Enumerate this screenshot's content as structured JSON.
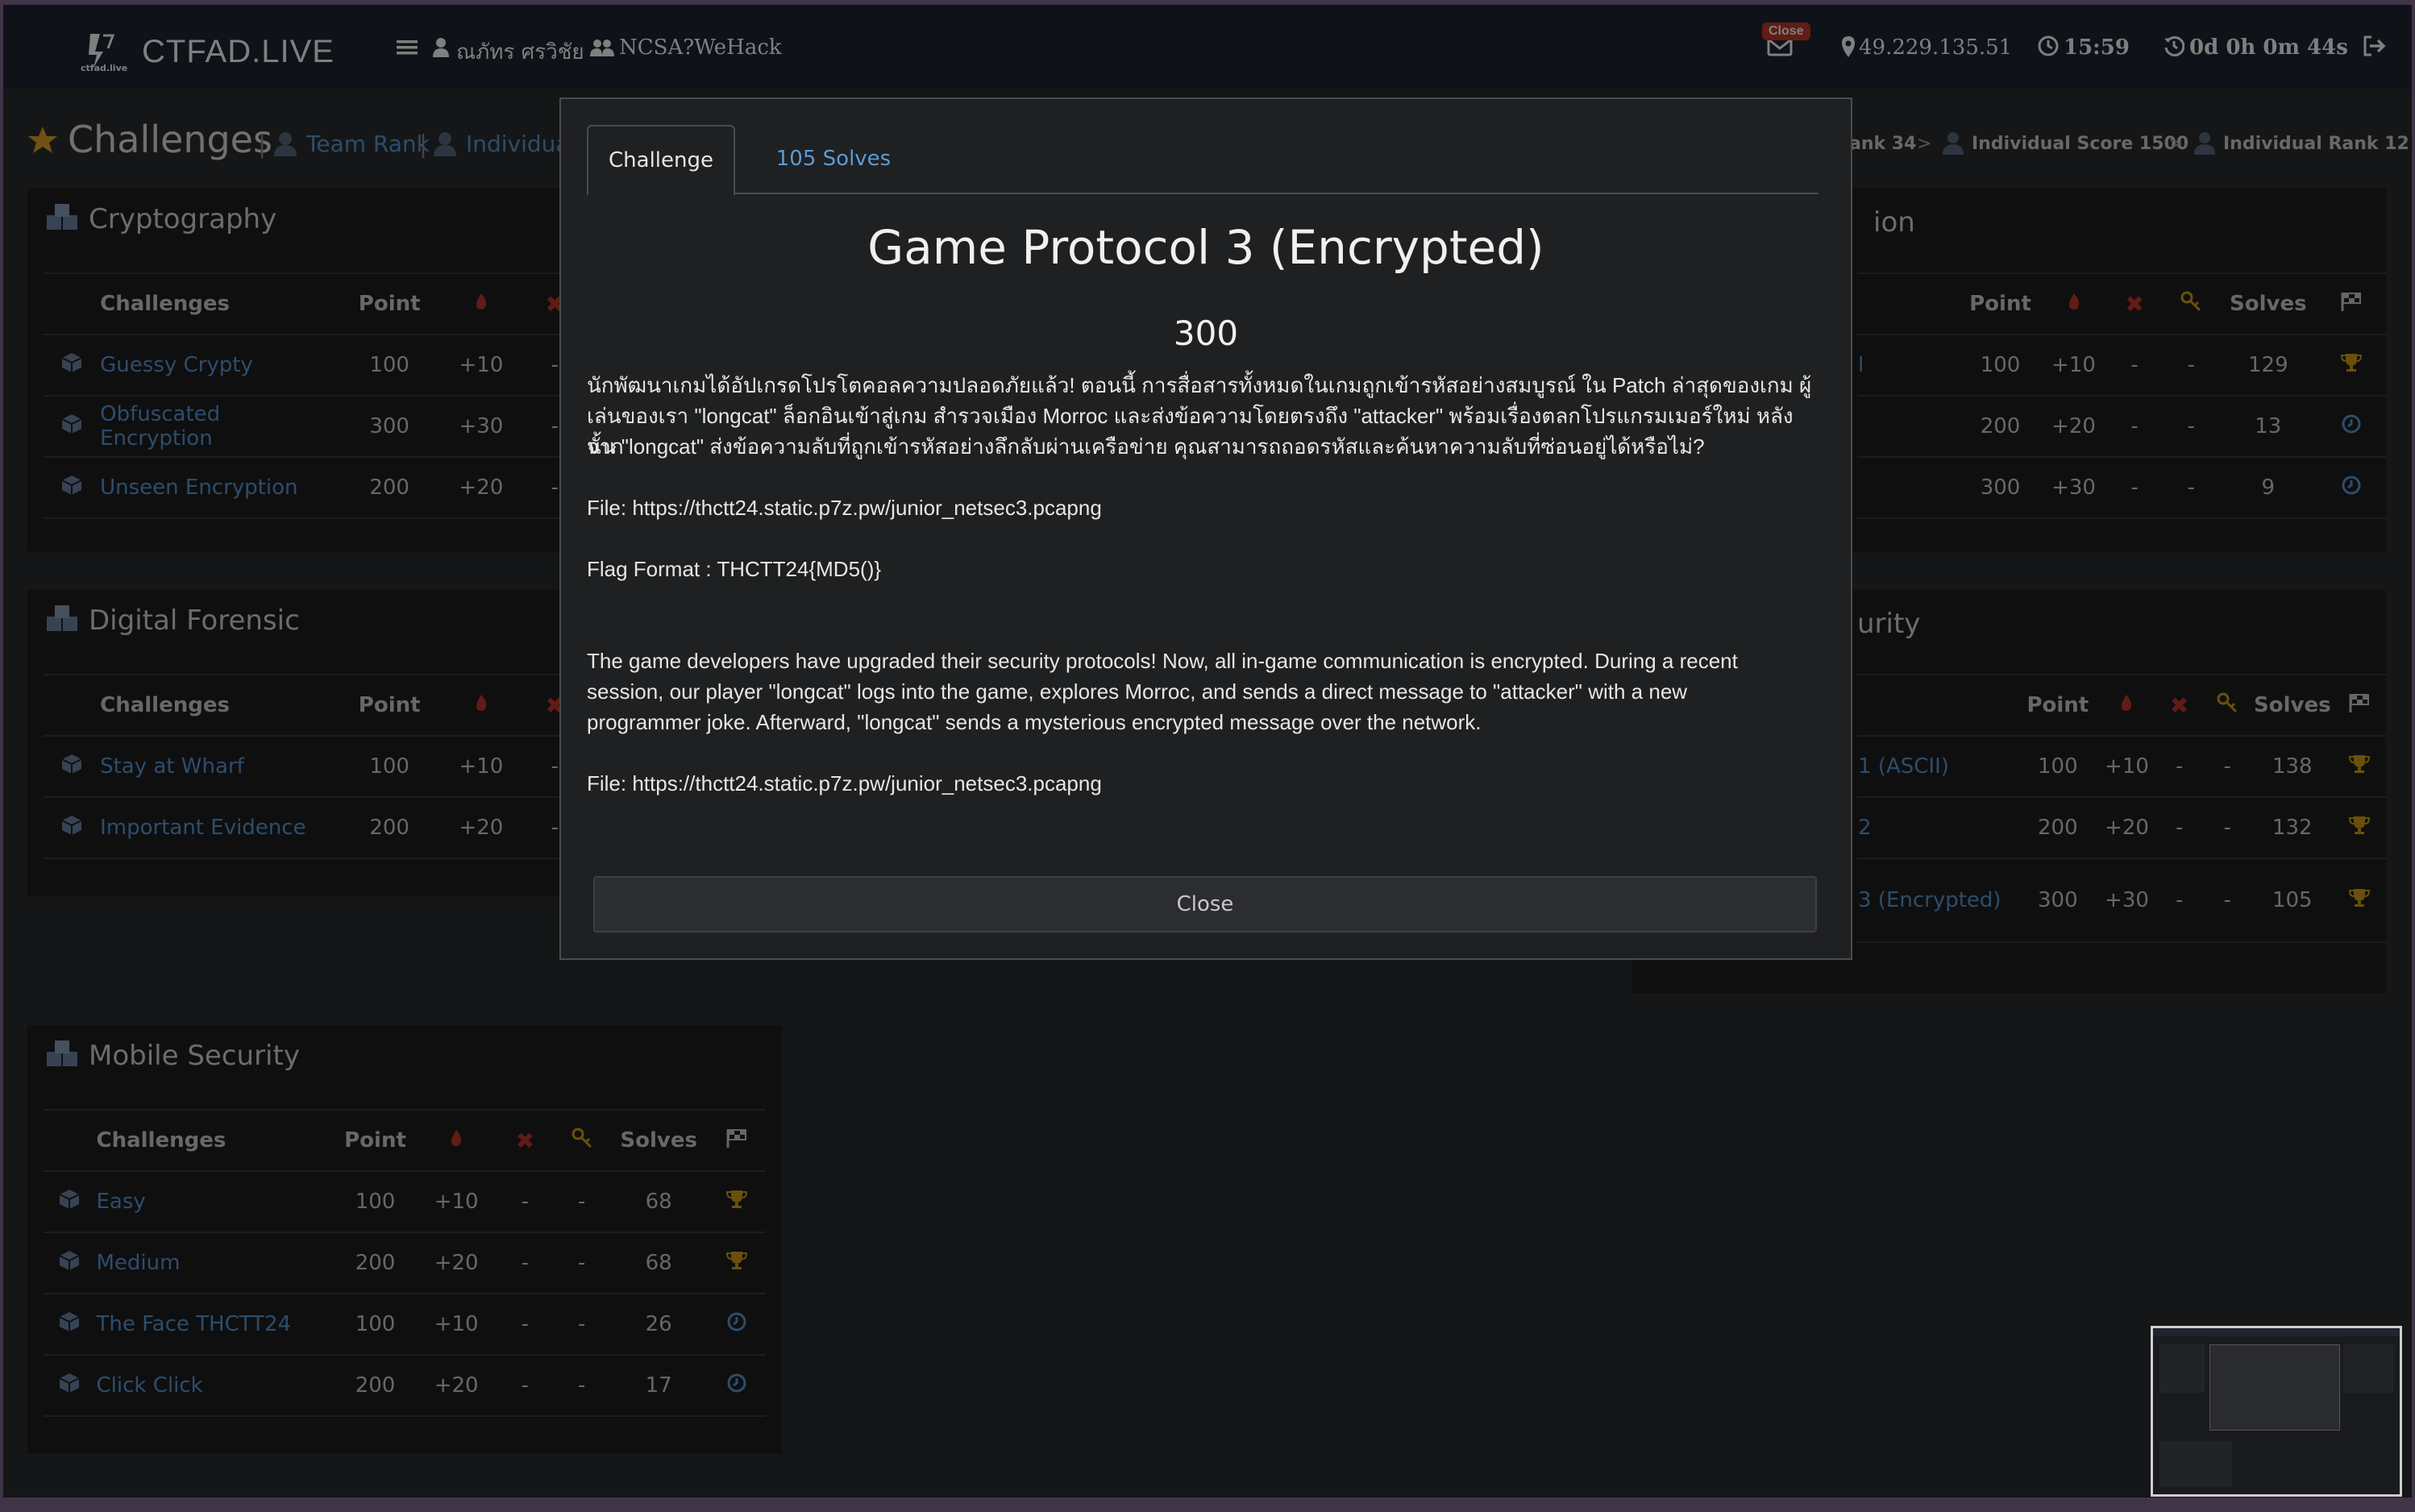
{
  "navbar": {
    "brand_title": "CTFAD.LIVE",
    "logo_caption": "ctfad.live",
    "user_name": "ณภัทร ศรวิชัย",
    "team_name": "NCSA?WeHack",
    "mail_badge": "Close",
    "ip_address": "49.229.135.51",
    "clock": "15:59",
    "timer": "0d 0h 0m 44s"
  },
  "page": {
    "heading": "Challenges",
    "breadcrumb_left": [
      "Team Rank",
      "Individua"
    ],
    "breadcrumb_right": {
      "team_rank": "ank 34",
      "individual_score": "Individual Score 1500",
      "individual_rank": "Individual Rank 12",
      "separator": ">"
    }
  },
  "columns": {
    "challenges": "Challenges",
    "point": "Point",
    "solves": "Solves"
  },
  "categories": {
    "cryptography": {
      "title": "Cryptography",
      "rows": [
        {
          "name": "Guessy Crypty",
          "point": "100",
          "bonus": "+10",
          "x": "-"
        },
        {
          "name": "Obfuscated Encryption",
          "point": "300",
          "bonus": "+30",
          "x": "-"
        },
        {
          "name": "Unseen Encryption",
          "point": "200",
          "bonus": "+20",
          "x": "-"
        }
      ]
    },
    "digital_forensic": {
      "title": "Digital Forensic",
      "rows": [
        {
          "name": "Stay at Wharf",
          "point": "100",
          "bonus": "+10",
          "x": "-"
        },
        {
          "name": "Important Evidence",
          "point": "200",
          "bonus": "+20",
          "x": "-"
        }
      ]
    },
    "right_top": {
      "title_fragment": "ion",
      "rows": [
        {
          "name": "l",
          "point": "100",
          "bonus": "+10",
          "x": "-",
          "key": "-",
          "solves": "129",
          "status": "trophy"
        },
        {
          "name": "",
          "point": "200",
          "bonus": "+20",
          "x": "-",
          "key": "-",
          "solves": "13",
          "status": "clock"
        },
        {
          "name": "",
          "point": "300",
          "bonus": "+30",
          "x": "-",
          "key": "-",
          "solves": "9",
          "status": "clock"
        }
      ]
    },
    "right_mid": {
      "title_fragment": "urity",
      "rows": [
        {
          "name": "1 (ASCII)",
          "point": "100",
          "bonus": "+10",
          "x": "-",
          "key": "-",
          "solves": "138",
          "status": "trophy"
        },
        {
          "name": "2",
          "point": "200",
          "bonus": "+20",
          "x": "-",
          "key": "-",
          "solves": "132",
          "status": "trophy"
        },
        {
          "name": "3 (Encrypted)",
          "point": "300",
          "bonus": "+30",
          "x": "-",
          "key": "-",
          "solves": "105",
          "status": "trophy"
        }
      ]
    },
    "mobile_security": {
      "title": "Mobile Security",
      "rows": [
        {
          "name": "Easy",
          "point": "100",
          "bonus": "+10",
          "x": "-",
          "key": "-",
          "solves": "68",
          "status": "trophy"
        },
        {
          "name": "Medium",
          "point": "200",
          "bonus": "+20",
          "x": "-",
          "key": "-",
          "solves": "68",
          "status": "trophy"
        },
        {
          "name": "The Face THCTT24",
          "point": "100",
          "bonus": "+10",
          "x": "-",
          "key": "-",
          "solves": "26",
          "status": "clock"
        },
        {
          "name": "Click Click",
          "point": "200",
          "bonus": "+20",
          "x": "-",
          "key": "-",
          "solves": "17",
          "status": "clock"
        }
      ]
    }
  },
  "modal": {
    "tabs": [
      "Challenge",
      "105 Solves"
    ],
    "title": "Game Protocol 3 (Encrypted)",
    "points": "300",
    "desc_th_1": "นักพัฒนาเกมได้อัปเกรดโปรโตคอลความปลอดภัยแล้ว! ตอนนี้ การสื่อสารทั้งหมดในเกมถูกเข้ารหัสอย่างสมบูรณ์ ใน Patch ล่าสุดของเกม ผู้",
    "desc_th_2": "เล่นของเรา \"longcat\" ล็อกอินเข้าสู่เกม สำรวจเมือง Morroc และส่งข้อความโดยตรงถึง \"attacker\" พร้อมเรื่องตลกโปรแกรมเมอร์ใหม่ หลังจาก",
    "desc_th_3": "นั้น \"longcat\" ส่งข้อความลับที่ถูกเข้ารหัสอย่างลึกลับผ่านเครือข่าย คุณสามารถถอดรหัสและค้นหาความลับที่ซ่อนอยู่ได้หรือไม่?",
    "file_1": "File: https://thctt24.static.p7z.pw/junior_netsec3.pcapng",
    "flag_format": "Flag Format : THCTT24{MD5()}",
    "desc_en_1": "The game developers have upgraded their security protocols! Now, all in-game communication is encrypted. During a recent",
    "desc_en_2": "session, our player \"longcat\" logs into the game, explores Morroc, and sends a direct message to \"attacker\" with a new",
    "desc_en_3": "programmer joke. Afterward, \"longcat\" sends a mysterious encrypted message over the network.",
    "file_2": "File: https://thctt24.static.p7z.pw/junior_netsec3.pcapng",
    "close_label": "Close"
  },
  "colors": {
    "link": "#5b9bd5",
    "trophy": "#d4a017",
    "flame": "#c0392b",
    "key": "#d4a017",
    "star": "#e0a526"
  },
  "icons": [
    "hamburger-icon",
    "user-icon",
    "users-icon",
    "mail-icon",
    "map-marker-icon",
    "clock-icon",
    "history-icon",
    "sign-out-icon",
    "star-icon",
    "cubes-icon",
    "cube-icon",
    "flame-icon",
    "x-icon",
    "key-icon",
    "flag-icon",
    "trophy-icon"
  ]
}
